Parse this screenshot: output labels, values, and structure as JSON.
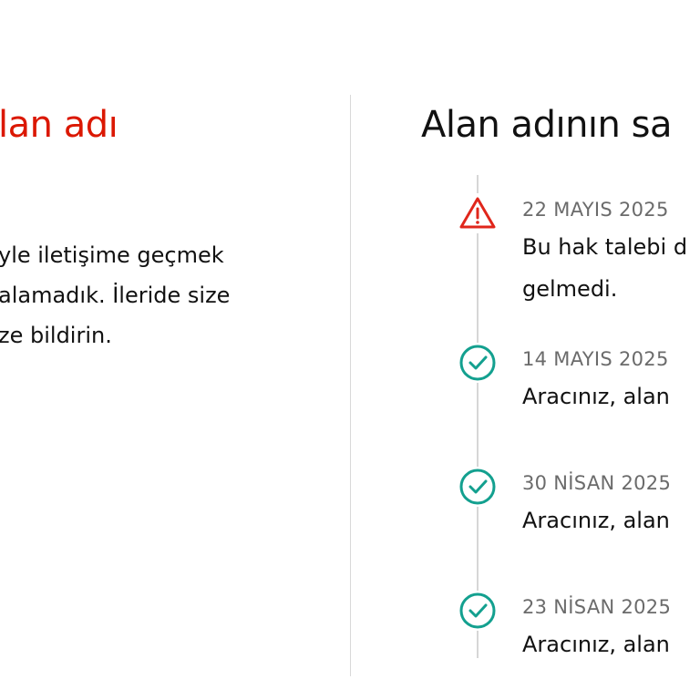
{
  "left": {
    "title": "lan adı",
    "lines": [
      "yle iletişime geçmek",
      "alamadık. İleride size",
      "ze bildirin."
    ]
  },
  "right": {
    "title": "Alan adının sa",
    "events": [
      {
        "icon": "warning-icon",
        "color": "#e0261b",
        "date": "22 MAYIS 2025",
        "lines": [
          "Bu hak talebi d",
          "gelmedi."
        ]
      },
      {
        "icon": "check-circle-icon",
        "color": "#13a08f",
        "date": "14 MAYIS 2025",
        "lines": [
          "Aracınız, alan"
        ]
      },
      {
        "icon": "check-circle-icon",
        "color": "#13a08f",
        "date": "30 NİSAN 2025",
        "lines": [
          "Aracınız, alan"
        ]
      },
      {
        "icon": "check-circle-icon",
        "color": "#13a08f",
        "date": "23 NİSAN 2025",
        "lines": [
          "Aracınız, alan"
        ]
      }
    ]
  }
}
